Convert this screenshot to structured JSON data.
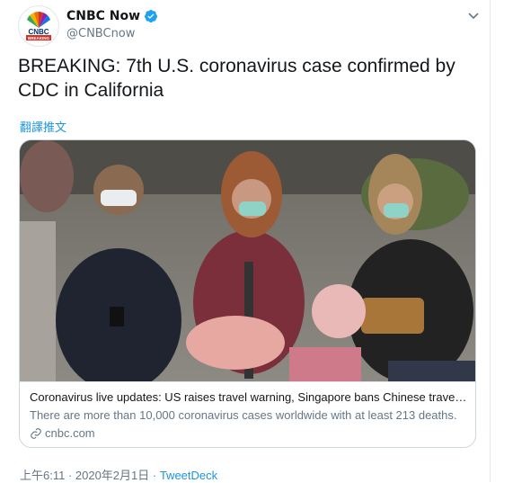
{
  "user": {
    "name": "CNBC Now",
    "handle": "@CNBCnow",
    "avatar_text": "BREAKING"
  },
  "tweet": {
    "text": "BREAKING: 7th U.S. coronavirus case confirmed by CDC in California",
    "translate_label": "翻譯推文"
  },
  "card": {
    "title": "Coronavirus live updates: US raises travel warning, Singapore bans Chinese travelers",
    "description": "There are more than 10,000 coronavirus cases worldwide with at least 213 deaths.",
    "domain": "cnbc.com"
  },
  "meta": {
    "timestamp": "上午6:11 · 2020年2月1日 · ",
    "source": "TweetDeck"
  },
  "colors": {
    "link": "#1b95e0",
    "verified": "#1da1f2",
    "muted": "#657786"
  }
}
